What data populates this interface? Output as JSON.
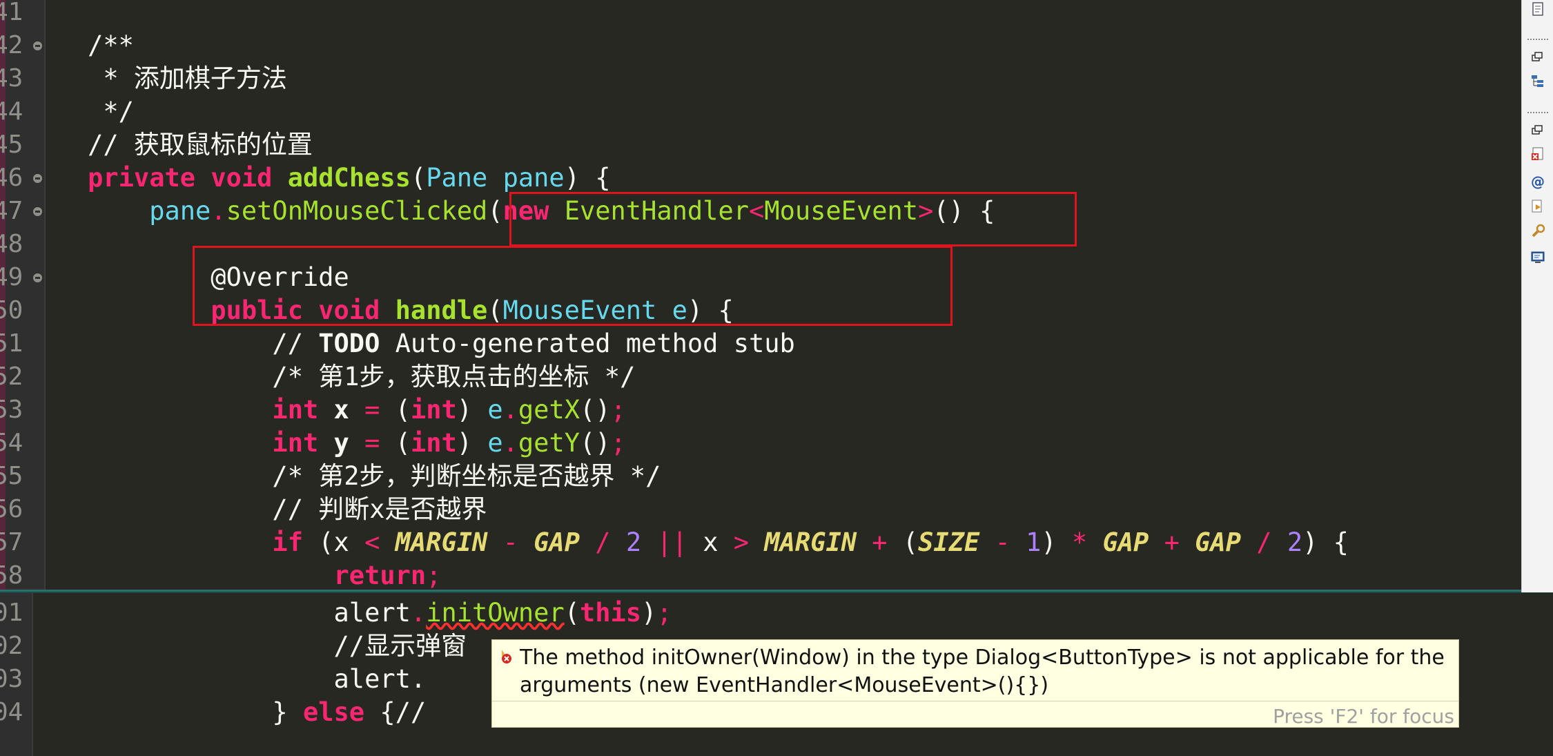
{
  "editor": {
    "top_lines": [
      {
        "num": "41",
        "fold": false,
        "parts": []
      },
      {
        "num": "42",
        "fold": true,
        "parts": [
          {
            "t": "    /**",
            "c": "cm"
          }
        ]
      },
      {
        "num": "43",
        "fold": false,
        "parts": [
          {
            "t": "     * 添加棋子方法",
            "c": "cm"
          }
        ]
      },
      {
        "num": "44",
        "fold": false,
        "parts": [
          {
            "t": "     */",
            "c": "cm"
          }
        ]
      },
      {
        "num": "45",
        "fold": false,
        "parts": [
          {
            "t": "    // 获取鼠标的位置",
            "c": "cm"
          }
        ]
      },
      {
        "num": "46",
        "fold": true,
        "parts": [
          {
            "t": "    ",
            "c": ""
          },
          {
            "t": "private",
            "c": "kw"
          },
          {
            "t": " ",
            "c": ""
          },
          {
            "t": "void",
            "c": "kw"
          },
          {
            "t": " ",
            "c": ""
          },
          {
            "t": "addChess",
            "c": "fn"
          },
          {
            "t": "(",
            "c": ""
          },
          {
            "t": "Pane",
            "c": "ty"
          },
          {
            "t": " ",
            "c": ""
          },
          {
            "t": "pane",
            "c": "pa"
          },
          {
            "t": ") {",
            "c": ""
          }
        ]
      },
      {
        "num": "47",
        "fold": true,
        "parts": [
          {
            "t": "        ",
            "c": ""
          },
          {
            "t": "pane",
            "c": "pa"
          },
          {
            "t": ".",
            "c": "op"
          },
          {
            "t": "setOnMouseClicked",
            "c": "fnl"
          },
          {
            "t": "(",
            "c": ""
          },
          {
            "t": "new",
            "c": "kw"
          },
          {
            "t": " ",
            "c": ""
          },
          {
            "t": "EventHandler",
            "c": "fnl"
          },
          {
            "t": "<",
            "c": "op"
          },
          {
            "t": "MouseEvent",
            "c": "fnl"
          },
          {
            "t": ">",
            "c": "op"
          },
          {
            "t": "() {",
            "c": ""
          }
        ]
      },
      {
        "num": "48",
        "fold": false,
        "parts": []
      },
      {
        "num": "49",
        "fold": true,
        "parts": [
          {
            "t": "            @Override",
            "c": "cm"
          }
        ]
      },
      {
        "num": "50",
        "fold": false,
        "parts": [
          {
            "t": "            ",
            "c": ""
          },
          {
            "t": "public",
            "c": "kw"
          },
          {
            "t": " ",
            "c": ""
          },
          {
            "t": "void",
            "c": "kw"
          },
          {
            "t": " ",
            "c": ""
          },
          {
            "t": "handle",
            "c": "fn"
          },
          {
            "t": "(",
            "c": ""
          },
          {
            "t": "MouseEvent",
            "c": "ty"
          },
          {
            "t": " ",
            "c": ""
          },
          {
            "t": "e",
            "c": "pa"
          },
          {
            "t": ") {",
            "c": ""
          }
        ]
      },
      {
        "num": "51",
        "fold": false,
        "parts": [
          {
            "t": "                // ",
            "c": "cm"
          },
          {
            "t": "TODO",
            "c": "todo"
          },
          {
            "t": " Auto-generated method stub",
            "c": "cm"
          }
        ]
      },
      {
        "num": "52",
        "fold": false,
        "parts": [
          {
            "t": "                /* 第1步，获取点击的坐标 */",
            "c": "cm"
          }
        ]
      },
      {
        "num": "53",
        "fold": false,
        "parts": [
          {
            "t": "                ",
            "c": ""
          },
          {
            "t": "int",
            "c": "kw"
          },
          {
            "t": " ",
            "c": ""
          },
          {
            "t": "x",
            "c": "vr"
          },
          {
            "t": " ",
            "c": ""
          },
          {
            "t": "=",
            "c": "op"
          },
          {
            "t": " (",
            "c": ""
          },
          {
            "t": "int",
            "c": "kw"
          },
          {
            "t": ") ",
            "c": ""
          },
          {
            "t": "e",
            "c": "pa"
          },
          {
            "t": ".",
            "c": "op"
          },
          {
            "t": "getX",
            "c": "fnl"
          },
          {
            "t": "()",
            "c": ""
          },
          {
            "t": ";",
            "c": "op"
          }
        ]
      },
      {
        "num": "54",
        "fold": false,
        "parts": [
          {
            "t": "                ",
            "c": ""
          },
          {
            "t": "int",
            "c": "kw"
          },
          {
            "t": " ",
            "c": ""
          },
          {
            "t": "y",
            "c": "vr"
          },
          {
            "t": " ",
            "c": ""
          },
          {
            "t": "=",
            "c": "op"
          },
          {
            "t": " (",
            "c": ""
          },
          {
            "t": "int",
            "c": "kw"
          },
          {
            "t": ") ",
            "c": ""
          },
          {
            "t": "e",
            "c": "pa"
          },
          {
            "t": ".",
            "c": "op"
          },
          {
            "t": "getY",
            "c": "fnl"
          },
          {
            "t": "()",
            "c": ""
          },
          {
            "t": ";",
            "c": "op"
          }
        ]
      },
      {
        "num": "55",
        "fold": false,
        "parts": [
          {
            "t": "                /* 第2步，判断坐标是否越界 */",
            "c": "cm"
          }
        ]
      },
      {
        "num": "56",
        "fold": false,
        "parts": [
          {
            "t": "                // 判断x是否越界",
            "c": "cm"
          }
        ]
      },
      {
        "num": "57",
        "fold": false,
        "parts": [
          {
            "t": "                ",
            "c": ""
          },
          {
            "t": "if",
            "c": "kw"
          },
          {
            "t": " (x ",
            "c": ""
          },
          {
            "t": "<",
            "c": "op"
          },
          {
            "t": " ",
            "c": ""
          },
          {
            "t": "MARGIN",
            "c": "const"
          },
          {
            "t": " ",
            "c": ""
          },
          {
            "t": "-",
            "c": "op"
          },
          {
            "t": " ",
            "c": ""
          },
          {
            "t": "GAP",
            "c": "const"
          },
          {
            "t": " ",
            "c": ""
          },
          {
            "t": "/",
            "c": "op"
          },
          {
            "t": " ",
            "c": ""
          },
          {
            "t": "2",
            "c": "num"
          },
          {
            "t": " ",
            "c": ""
          },
          {
            "t": "||",
            "c": "op"
          },
          {
            "t": " x ",
            "c": ""
          },
          {
            "t": ">",
            "c": "op"
          },
          {
            "t": " ",
            "c": ""
          },
          {
            "t": "MARGIN",
            "c": "const"
          },
          {
            "t": " ",
            "c": ""
          },
          {
            "t": "+",
            "c": "op"
          },
          {
            "t": " (",
            "c": ""
          },
          {
            "t": "SIZE",
            "c": "const"
          },
          {
            "t": " ",
            "c": ""
          },
          {
            "t": "-",
            "c": "op"
          },
          {
            "t": " ",
            "c": ""
          },
          {
            "t": "1",
            "c": "num"
          },
          {
            "t": ") ",
            "c": ""
          },
          {
            "t": "*",
            "c": "op"
          },
          {
            "t": " ",
            "c": ""
          },
          {
            "t": "GAP",
            "c": "const"
          },
          {
            "t": " ",
            "c": ""
          },
          {
            "t": "+",
            "c": "op"
          },
          {
            "t": " ",
            "c": ""
          },
          {
            "t": "GAP",
            "c": "const"
          },
          {
            "t": " ",
            "c": ""
          },
          {
            "t": "/",
            "c": "op"
          },
          {
            "t": " ",
            "c": ""
          },
          {
            "t": "2",
            "c": "num"
          },
          {
            "t": ") {",
            "c": ""
          }
        ]
      },
      {
        "num": "58",
        "fold": false,
        "parts": [
          {
            "t": "                    ",
            "c": ""
          },
          {
            "t": "return",
            "c": "kw"
          },
          {
            "t": ";",
            "c": "op"
          }
        ]
      }
    ],
    "bottom_lines": [
      {
        "num": "01",
        "parts": [
          {
            "t": "                    alert",
            "c": ""
          },
          {
            "t": ".",
            "c": "op"
          },
          {
            "t": "initOwner",
            "c": "err"
          },
          {
            "t": "(",
            "c": ""
          },
          {
            "t": "this",
            "c": "kw"
          },
          {
            "t": ")",
            "c": ""
          },
          {
            "t": ";",
            "c": "op"
          }
        ]
      },
      {
        "num": "02",
        "parts": [
          {
            "t": "                    //显示弹窗",
            "c": "cm"
          }
        ]
      },
      {
        "num": "03",
        "parts": [
          {
            "t": "                    alert.",
            "c": ""
          }
        ]
      },
      {
        "num": "04",
        "parts": [
          {
            "t": "                ",
            "c": ""
          },
          {
            "t": "} ",
            "c": ""
          },
          {
            "t": "else",
            "c": "kw"
          },
          {
            "t": " {//",
            "c": ""
          }
        ]
      }
    ]
  },
  "tooltip": {
    "message": "The method initOwner(Window) in the type Dialog<ButtonType> is not applicable for the arguments (new EventHandler<MouseEvent>(){})",
    "focus_hint": "Press 'F2' for focus"
  },
  "right_panel": {
    "icons": [
      "outline-view-icon",
      "restore-icon",
      "hierarchy-icon",
      "restore-icon",
      "problems-icon",
      "javadoc-icon",
      "declaration-icon",
      "search-icon",
      "console-icon"
    ]
  },
  "colors": {
    "background": "#272822",
    "keyword": "#f92672",
    "function": "#a6e22e",
    "type": "#66d9ef",
    "number": "#ae81ff",
    "constant": "#e6db74",
    "highlight_box": "#e0141e",
    "tooltip_bg": "#ffffe1"
  }
}
